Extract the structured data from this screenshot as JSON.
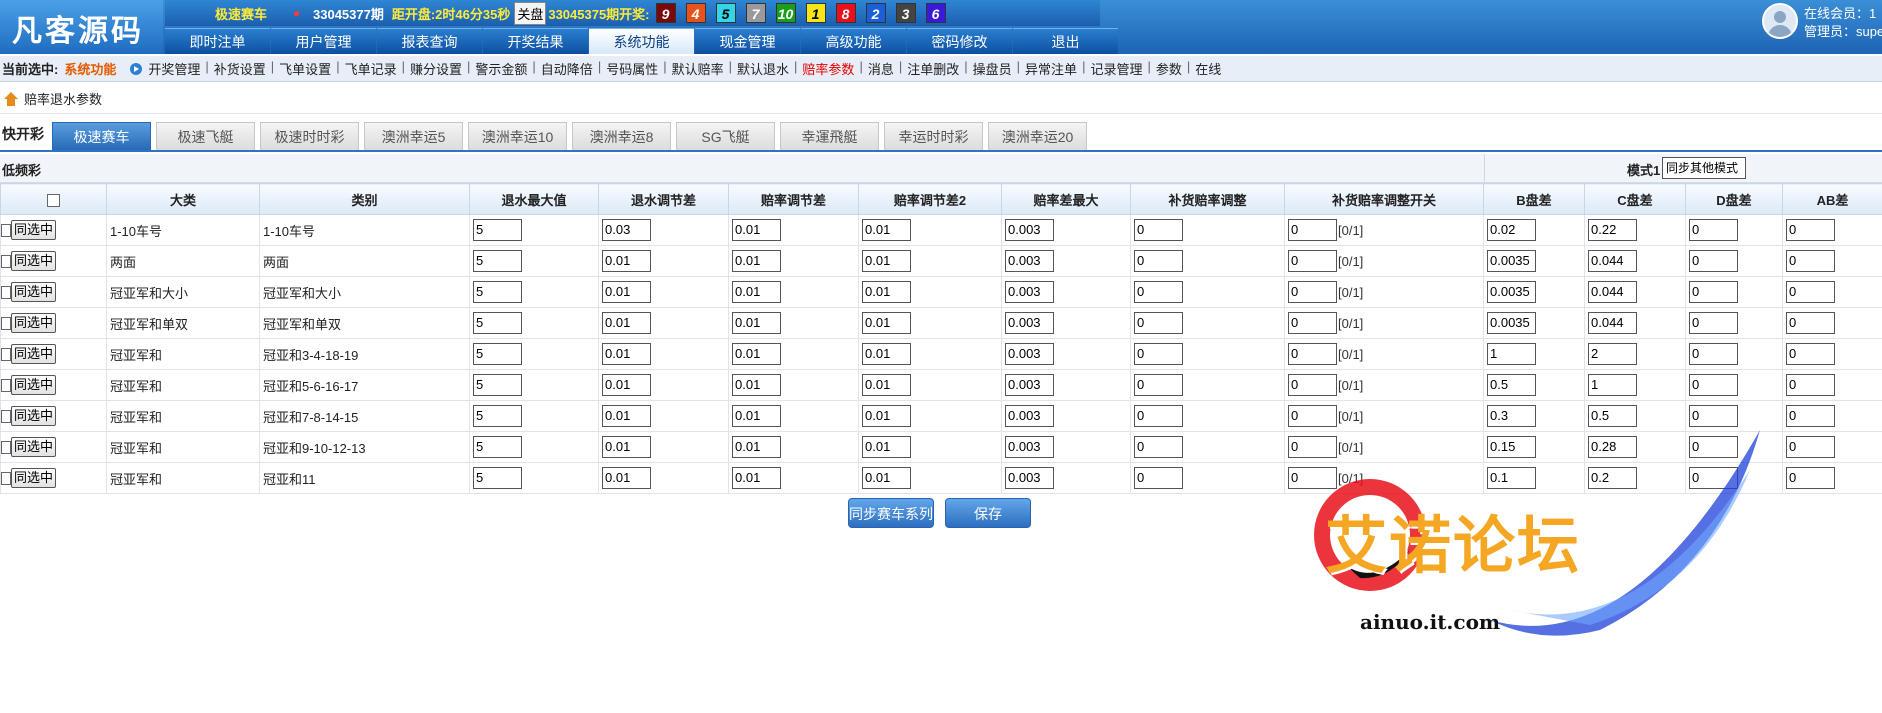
{
  "header": {
    "logo": "凡客源码",
    "game_name": "极速赛车",
    "game_caret": "●",
    "issue": "33045377期",
    "countdown": "距开盘:2时46分35秒",
    "close_button": "关盘",
    "prev_issue": "33045375期开奖:",
    "balls": [
      {
        "num": "9",
        "color": "#7a0a0a"
      },
      {
        "num": "4",
        "color": "#e8531b"
      },
      {
        "num": "5",
        "color": "#35d5e8"
      },
      {
        "num": "7",
        "color": "#9a9a9a"
      },
      {
        "num": "10",
        "color": "#1a9f1a"
      },
      {
        "num": "1",
        "color": "#f5e51a"
      },
      {
        "num": "8",
        "color": "#e8101a"
      },
      {
        "num": "2",
        "color": "#1a5fd8"
      },
      {
        "num": "3",
        "color": "#444444"
      },
      {
        "num": "6",
        "color": "#3a1ad8"
      }
    ],
    "nav_tabs": [
      "即时注单",
      "用户管理",
      "报表查询",
      "开奖结果",
      "系统功能",
      "现金管理",
      "高级功能",
      "密码修改",
      "退出"
    ],
    "active_tab": "系统功能",
    "online_members": "在线会员：1",
    "admin": "管理员：supe"
  },
  "crumbbar": {
    "label": "当前选中:",
    "section": "系统功能",
    "items": [
      "开奖管理",
      "补货设置",
      "飞单设置",
      "飞单记录",
      "赚分设置",
      "警示金额",
      "自动降倍",
      "号码属性",
      "默认赔率",
      "默认退水",
      "赔率参数",
      "消息",
      "注单删改",
      "操盘员",
      "异常注单",
      "记录管理",
      "参数",
      "在线"
    ],
    "active_item": "赔率参数"
  },
  "page_title": "赔率退水参数",
  "games": {
    "label": "快开彩",
    "tabs": [
      "极速赛车",
      "极速飞艇",
      "极速时时彩",
      "澳洲幸运5",
      "澳洲幸运10",
      "澳洲幸运8",
      "SG飞艇",
      "幸運飛艇",
      "幸运时时彩",
      "澳洲幸运20"
    ],
    "active": "极速赛车"
  },
  "table": {
    "section_label": "低频彩",
    "mode_label": "模式1",
    "mode_select": "同步其他模式",
    "columns": [
      "大类",
      "类别",
      "退水最大值",
      "退水调节差",
      "赔率调节差",
      "赔率调节差2",
      "赔率差最大",
      "补货赔率调整",
      "补货赔率调整开关",
      "B盘差",
      "C盘差",
      "D盘差",
      "AB差"
    ],
    "sync_label": "同选中",
    "switch_hint": "[0/1]",
    "rows": [
      {
        "cat": "1-10车号",
        "type": "1-10车号",
        "v": [
          "5",
          "0.03",
          "0.01",
          "0.01",
          "0.003",
          "0",
          "0",
          "0.02",
          "0.22",
          "0",
          "0"
        ]
      },
      {
        "cat": "两面",
        "type": "两面",
        "v": [
          "5",
          "0.01",
          "0.01",
          "0.01",
          "0.003",
          "0",
          "0",
          "0.0035",
          "0.044",
          "0",
          "0"
        ]
      },
      {
        "cat": "冠亚军和大小",
        "type": "冠亚军和大小",
        "v": [
          "5",
          "0.01",
          "0.01",
          "0.01",
          "0.003",
          "0",
          "0",
          "0.0035",
          "0.044",
          "0",
          "0"
        ]
      },
      {
        "cat": "冠亚军和单双",
        "type": "冠亚军和单双",
        "v": [
          "5",
          "0.01",
          "0.01",
          "0.01",
          "0.003",
          "0",
          "0",
          "0.0035",
          "0.044",
          "0",
          "0"
        ]
      },
      {
        "cat": "冠亚军和",
        "type": "冠亚和3-4-18-19",
        "v": [
          "5",
          "0.01",
          "0.01",
          "0.01",
          "0.003",
          "0",
          "0",
          "1",
          "2",
          "0",
          "0"
        ]
      },
      {
        "cat": "冠亚军和",
        "type": "冠亚和5-6-16-17",
        "v": [
          "5",
          "0.01",
          "0.01",
          "0.01",
          "0.003",
          "0",
          "0",
          "0.5",
          "1",
          "0",
          "0"
        ]
      },
      {
        "cat": "冠亚军和",
        "type": "冠亚和7-8-14-15",
        "v": [
          "5",
          "0.01",
          "0.01",
          "0.01",
          "0.003",
          "0",
          "0",
          "0.3",
          "0.5",
          "0",
          "0"
        ]
      },
      {
        "cat": "冠亚军和",
        "type": "冠亚和9-10-12-13",
        "v": [
          "5",
          "0.01",
          "0.01",
          "0.01",
          "0.003",
          "0",
          "0",
          "0.15",
          "0.28",
          "0",
          "0"
        ]
      },
      {
        "cat": "冠亚军和",
        "type": "冠亚和11",
        "v": [
          "5",
          "0.01",
          "0.01",
          "0.01",
          "0.003",
          "0",
          "0",
          "0.1",
          "0.2",
          "0",
          "0"
        ]
      }
    ]
  },
  "buttons": {
    "sync_series": "同步赛车系列",
    "save": "保存"
  },
  "watermark": {
    "text": "艾诺论坛",
    "url": "ainuo.it.com"
  }
}
